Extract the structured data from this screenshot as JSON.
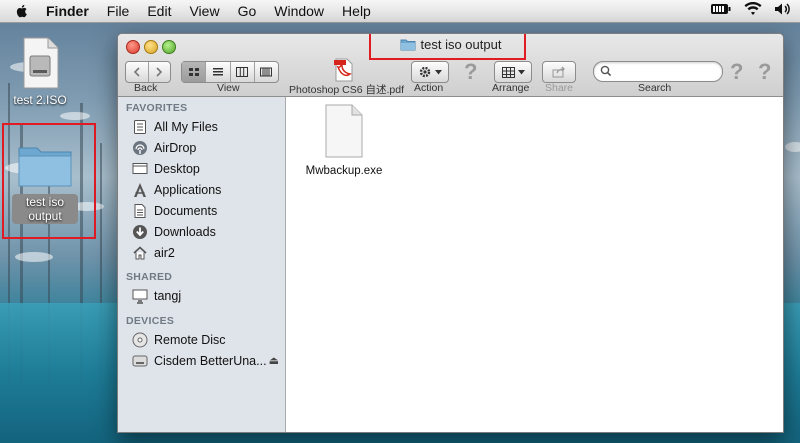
{
  "menubar": {
    "items": [
      "Finder",
      "File",
      "Edit",
      "View",
      "Go",
      "Window",
      "Help"
    ]
  },
  "desktop": {
    "icons": [
      {
        "label": "test 2.ISO"
      },
      {
        "label_line1": "test iso",
        "label_line2": "output"
      }
    ]
  },
  "window": {
    "title": "test iso output",
    "toolbar": {
      "back_label": "Back",
      "view_label": "View",
      "pdf_label": "Photoshop CS6 自述.pdf",
      "action_label": "Action",
      "arrange_label": "Arrange",
      "share_label": "Share",
      "search_label": "Search",
      "search_placeholder": ""
    },
    "sidebar": {
      "favorites_header": "FAVORITES",
      "favorites": [
        "All My Files",
        "AirDrop",
        "Desktop",
        "Applications",
        "Documents",
        "Downloads",
        "air2"
      ],
      "shared_header": "SHARED",
      "shared": [
        "tangj"
      ],
      "devices_header": "DEVICES",
      "devices": [
        "Remote Disc",
        "Cisdem BetterUna..."
      ]
    },
    "files": [
      {
        "name": "Mwbackup.exe"
      }
    ]
  },
  "colors": {
    "highlight": "#e01b24",
    "sidebar": "#dfe4ea"
  }
}
